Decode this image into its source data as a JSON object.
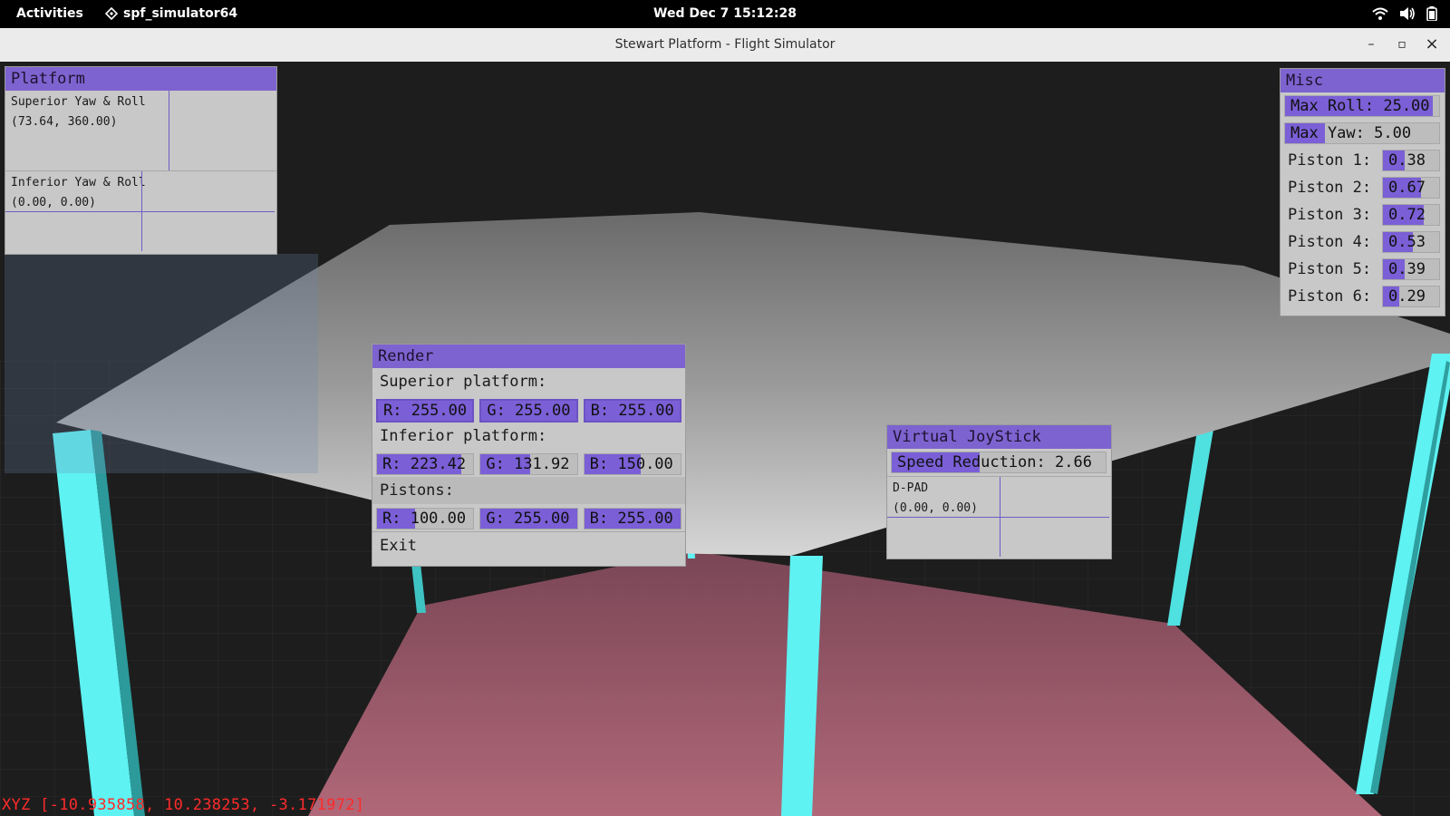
{
  "topbar": {
    "activities": "Activities",
    "app_name": "spf_simulator64",
    "clock": "Wed Dec 7  15:12:28",
    "icons": [
      "wifi-icon",
      "volume-icon",
      "battery-icon"
    ]
  },
  "window": {
    "title": "Stewart Platform - Flight Simulator",
    "minimize": "–",
    "maximize": "▫",
    "close": "×"
  },
  "platform_panel": {
    "title": "Platform",
    "superior_label": "Superior Yaw & Roll",
    "superior_value": "(73.64, 360.00)",
    "inferior_label": "Inferior Yaw & Roll",
    "inferior_value": "(0.00, 0.00)"
  },
  "misc_panel": {
    "title": "Misc",
    "max_roll": {
      "label": "Max Roll: 25.00",
      "fraction": 0.96
    },
    "max_yaw": {
      "label": "Max Yaw: 5.00",
      "fraction": 0.26
    },
    "pistons": [
      {
        "label": "Piston 1:",
        "value": "0.38",
        "fraction": 0.38
      },
      {
        "label": "Piston 2:",
        "value": "0.67",
        "fraction": 0.67
      },
      {
        "label": "Piston 3:",
        "value": "0.72",
        "fraction": 0.72
      },
      {
        "label": "Piston 4:",
        "value": "0.53",
        "fraction": 0.53
      },
      {
        "label": "Piston 5:",
        "value": "0.39",
        "fraction": 0.39
      },
      {
        "label": "Piston 6:",
        "value": "0.29",
        "fraction": 0.29
      }
    ]
  },
  "render_panel": {
    "title": "Render",
    "superior_label": "Superior platform:",
    "superior": [
      {
        "label": "R: 255.00",
        "fraction": 1.0
      },
      {
        "label": "G: 255.00",
        "fraction": 1.0
      },
      {
        "label": "B: 255.00",
        "fraction": 1.0
      }
    ],
    "inferior_label": "Inferior platform:",
    "inferior": [
      {
        "label": "R: 223.42",
        "fraction": 0.876
      },
      {
        "label": "G: 131.92",
        "fraction": 0.517
      },
      {
        "label": "B: 150.00",
        "fraction": 0.588
      }
    ],
    "pistons_label": "Pistons:",
    "pistons": [
      {
        "label": "R: 100.00",
        "fraction": 0.392
      },
      {
        "label": "G: 255.00",
        "fraction": 1.0
      },
      {
        "label": "B: 255.00",
        "fraction": 1.0
      }
    ],
    "exit": "Exit"
  },
  "joystick_panel": {
    "title": "Virtual JoyStick",
    "speed_reduction": {
      "label": "Speed Reduction: 2.66",
      "fraction": 0.41
    },
    "dpad_label": "D-PAD",
    "dpad_value": "(0.00, 0.00)"
  },
  "coords": "XYZ [-10.935858, 10.238253, -3.171972]",
  "colors": {
    "accent": "#7d63cf",
    "panel_bg": "#c8c8c8",
    "piston": "#5ef2f2",
    "inferior_platform": "#a35a6e",
    "superior_platform": "#bdbdbd",
    "coords_text": "#ff2a2a"
  }
}
